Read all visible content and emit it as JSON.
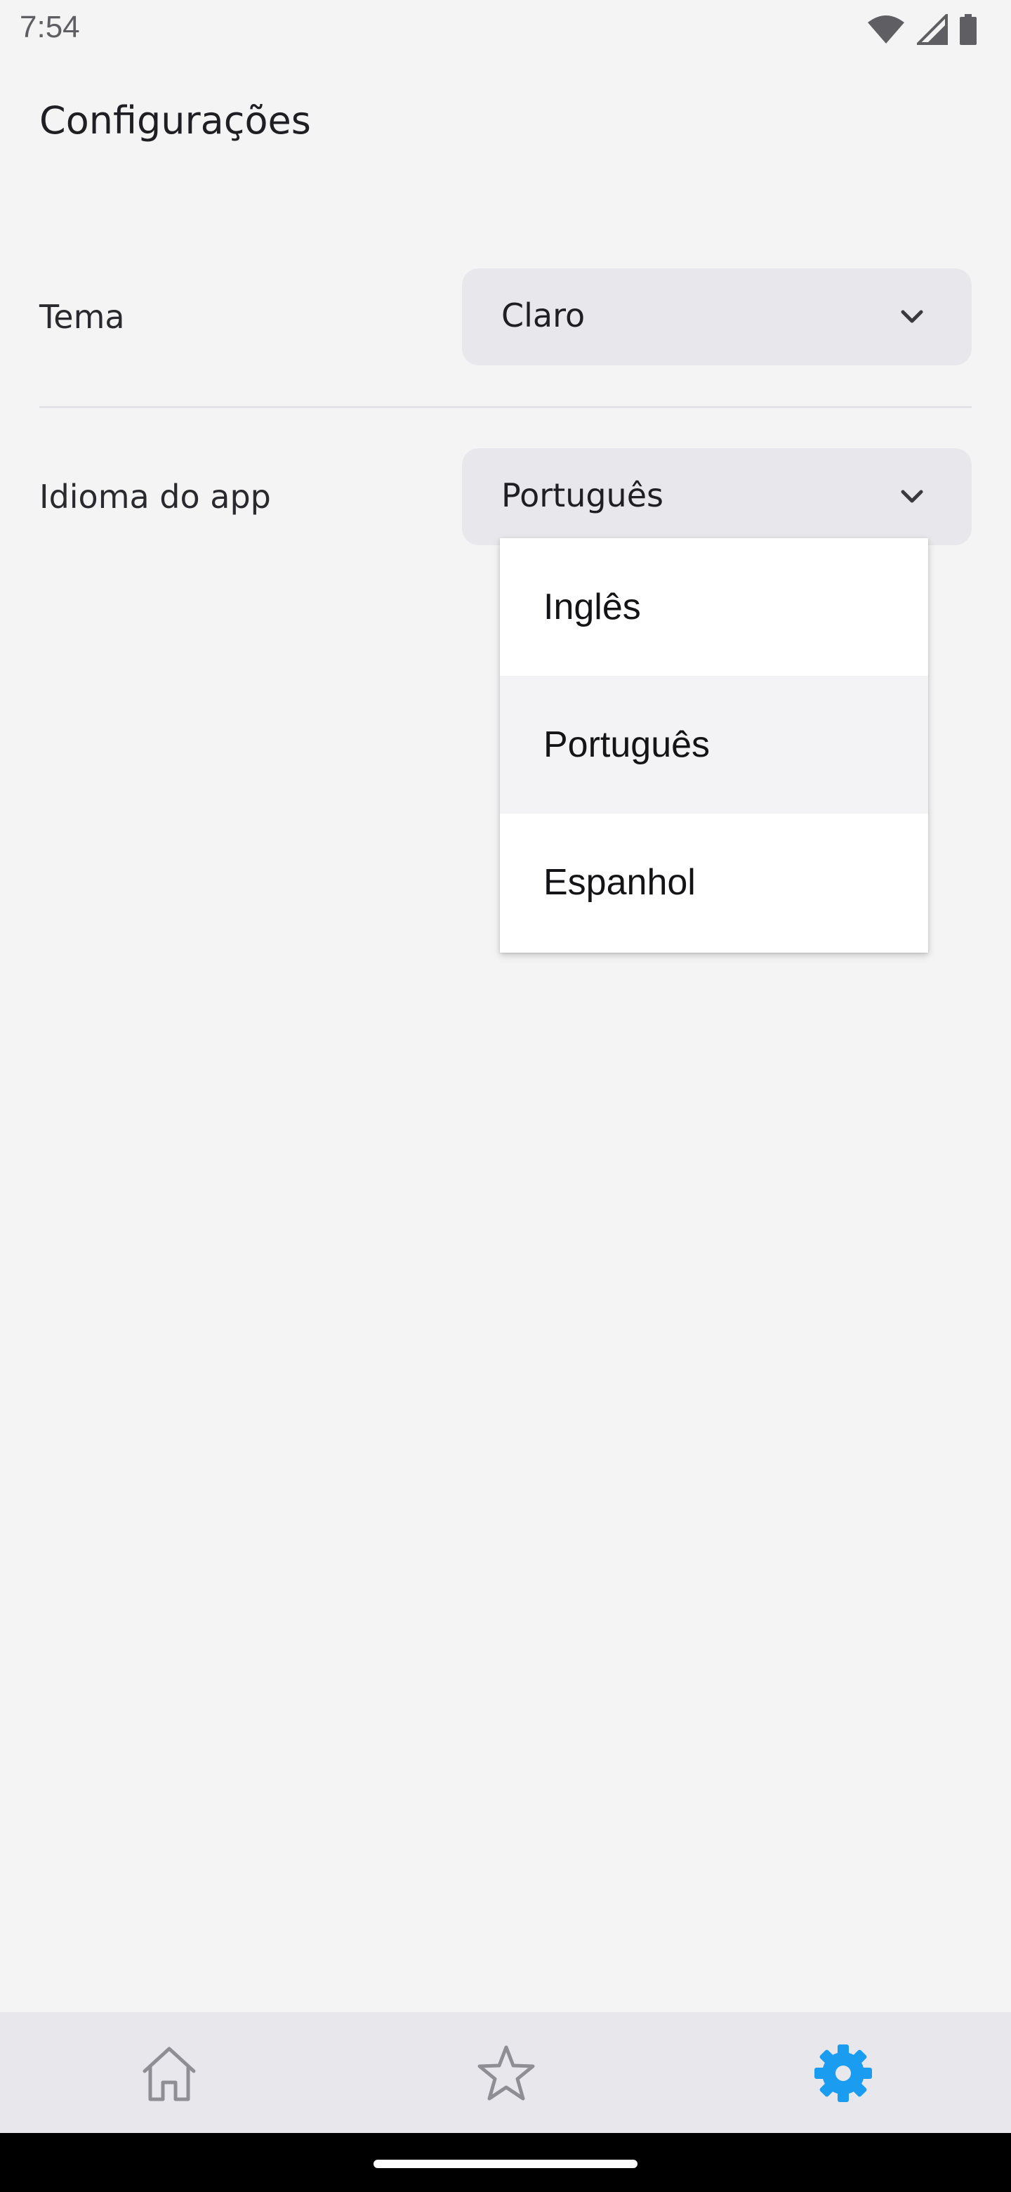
{
  "status_bar": {
    "time": "7:54",
    "icons": [
      "wifi-icon",
      "cellular-signal-icon",
      "battery-icon"
    ]
  },
  "header": {
    "title": "Configurações"
  },
  "settings": {
    "theme": {
      "label": "Tema",
      "value": "Claro"
    },
    "language": {
      "label": "Idioma do app",
      "value": "Português",
      "options": [
        "Inglês",
        "Português",
        "Espanhol"
      ],
      "selected_index": 1
    }
  },
  "bottom_nav": {
    "items": [
      {
        "icon": "home-icon",
        "active": false
      },
      {
        "icon": "star-icon",
        "active": false
      },
      {
        "icon": "gear-icon",
        "active": true
      }
    ],
    "active_color": "#1a9cf0",
    "inactive_color": "#8e8e94"
  },
  "colors": {
    "background": "#f4f4f5",
    "select_background": "#e8e8ec",
    "nav_background": "#e8e8ec"
  }
}
